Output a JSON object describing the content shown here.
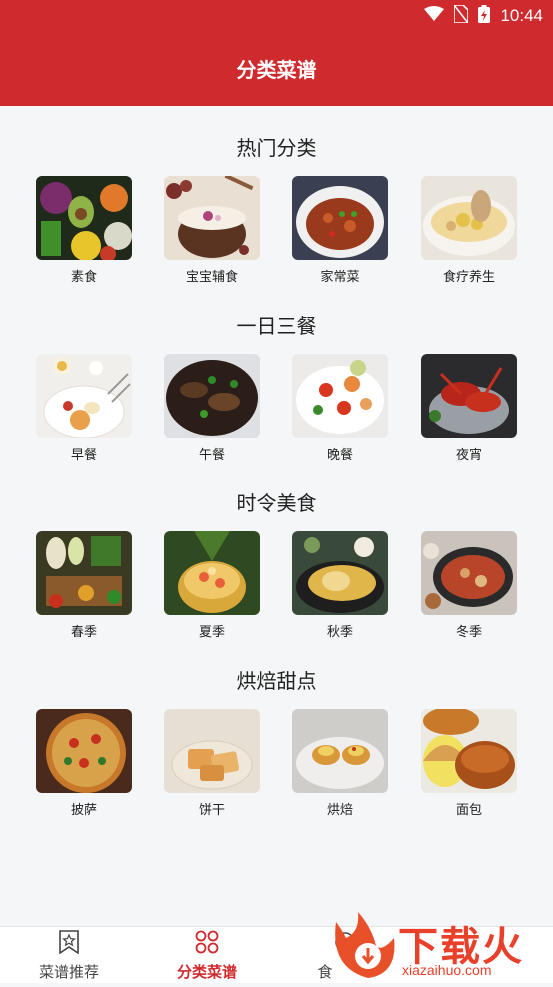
{
  "status_bar": {
    "time": "10:44"
  },
  "header": {
    "title": "分类菜谱"
  },
  "sections": [
    {
      "title": "热门分类",
      "items": [
        {
          "label": "素食",
          "icon": "vegetarian-food-photo"
        },
        {
          "label": "宝宝辅食",
          "icon": "baby-food-photo"
        },
        {
          "label": "家常菜",
          "icon": "home-cooking-photo"
        },
        {
          "label": "食疗养生",
          "icon": "health-soup-photo"
        }
      ]
    },
    {
      "title": "一日三餐",
      "items": [
        {
          "label": "早餐",
          "icon": "breakfast-photo"
        },
        {
          "label": "午餐",
          "icon": "lunch-photo"
        },
        {
          "label": "晚餐",
          "icon": "dinner-photo"
        },
        {
          "label": "夜宵",
          "icon": "late-night-snack-photo"
        }
      ]
    },
    {
      "title": "时令美食",
      "items": [
        {
          "label": "春季",
          "icon": "spring-food-photo"
        },
        {
          "label": "夏季",
          "icon": "summer-food-photo"
        },
        {
          "label": "秋季",
          "icon": "autumn-food-photo"
        },
        {
          "label": "冬季",
          "icon": "winter-food-photo"
        }
      ]
    },
    {
      "title": "烘焙甜点",
      "items": [
        {
          "label": "披萨",
          "icon": "pizza-photo"
        },
        {
          "label": "饼干",
          "icon": "cookies-photo"
        },
        {
          "label": "烘焙",
          "icon": "baking-photo"
        },
        {
          "label": "面包",
          "icon": "bread-photo"
        }
      ]
    }
  ],
  "tabs": [
    {
      "label": "菜谱推荐",
      "icon": "bookmark-star-icon",
      "active": false
    },
    {
      "label": "分类菜谱",
      "icon": "grid-circles-icon",
      "active": true
    },
    {
      "label": "食",
      "icon": "food-icon",
      "active": false
    }
  ],
  "watermark": {
    "text": "下载火",
    "url_text": "xiazaihuo.com"
  },
  "colors": {
    "accent": "#cf2a2e",
    "background": "#f5f6f8",
    "tab_inactive": "#444444"
  }
}
